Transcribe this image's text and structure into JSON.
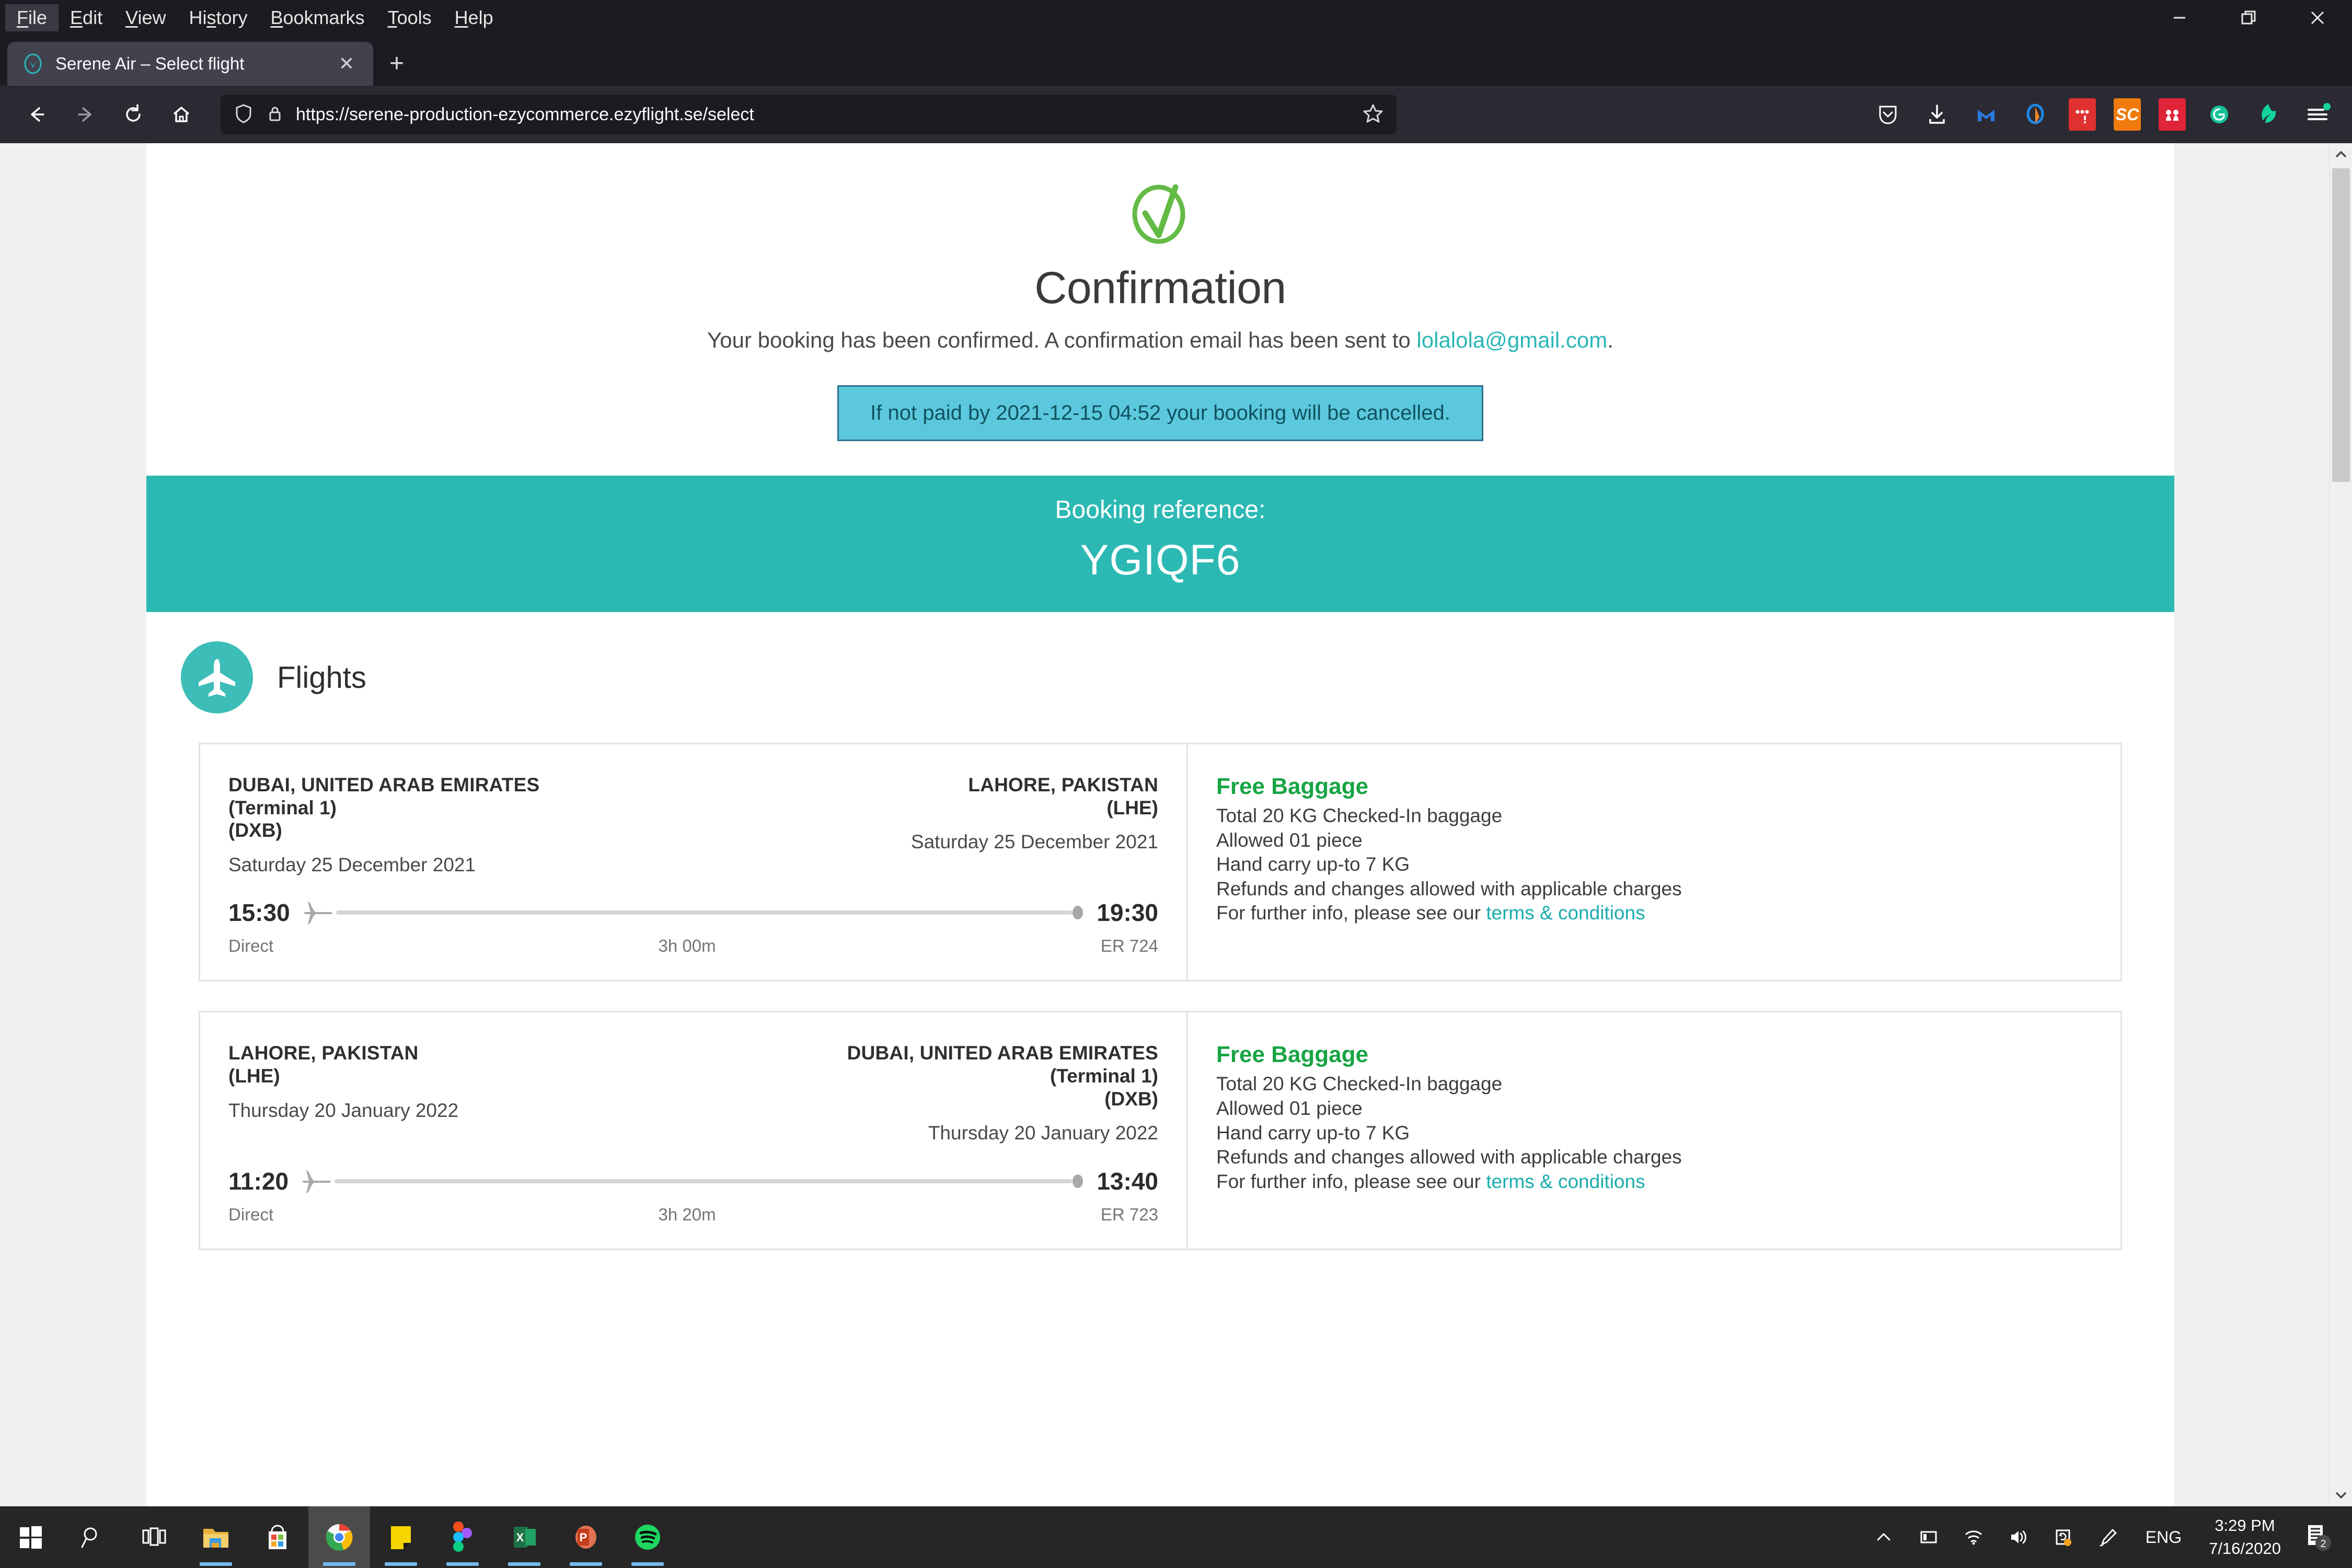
{
  "browser": {
    "menu": [
      {
        "label": "File",
        "accel": "F",
        "active": true
      },
      {
        "label": "Edit",
        "accel": "E",
        "active": false
      },
      {
        "label": "View",
        "accel": "V",
        "active": false
      },
      {
        "label": "History",
        "accel": "s",
        "active": false
      },
      {
        "label": "Bookmarks",
        "accel": "B",
        "active": false
      },
      {
        "label": "Tools",
        "accel": "T",
        "active": false
      },
      {
        "label": "Help",
        "accel": "H",
        "active": false
      }
    ],
    "tab": {
      "title": "Serene Air – Select flight",
      "close_label": "✕",
      "newtab_label": "+"
    },
    "url": "https://serene-production-ezycommerce.ezyflight.se/select",
    "extensions": [
      {
        "name": "pocket-icon",
        "label": ""
      },
      {
        "name": "downloads-icon",
        "label": ""
      },
      {
        "name": "malwarebytes-icon",
        "label": "M"
      },
      {
        "name": "origin-icon",
        "label": ""
      },
      {
        "name": "alert-extension-icon",
        "label": "!"
      },
      {
        "name": "sc-extension-icon",
        "label": "SC"
      },
      {
        "name": "m-extension-icon",
        "label": "M"
      },
      {
        "name": "grammarly-icon",
        "label": "G"
      },
      {
        "name": "leaf-extension-icon",
        "label": ""
      },
      {
        "name": "app-menu-icon",
        "label": ""
      }
    ],
    "window_buttons": {
      "minimize": "minimize-button",
      "restore": "restore-button",
      "close": "close-button"
    }
  },
  "page": {
    "confirmation": {
      "title": "Confirmation",
      "message_before": "Your booking has been confirmed. A confirmation email has been sent to ",
      "email": "lolalola@gmail.com",
      "message_after": ".",
      "warning": "If not paid by 2021-12-15 04:52 your booking will be cancelled."
    },
    "booking_reference": {
      "label": "Booking reference:",
      "code": "YGIQF6"
    },
    "flights_section": {
      "title": "Flights",
      "cards": [
        {
          "origin_name": "DUBAI, UNITED ARAB EMIRATES",
          "origin_terminal": "(Terminal 1)",
          "origin_code": "(DXB)",
          "origin_date": "Saturday 25 December 2021",
          "destination_name": "LAHORE, PAKISTAN",
          "destination_terminal": "",
          "destination_code": "(LHE)",
          "destination_date": "Saturday 25 December 2021",
          "depart_time": "15:30",
          "arrive_time": "19:30",
          "stops": "Direct",
          "duration": "3h 00m",
          "flight_number": "ER 724",
          "baggage_title": "Free Baggage",
          "baggage_lines": [
            "Total 20 KG Checked-In baggage",
            "Allowed 01 piece",
            "Hand carry up-to 7 KG",
            "Refunds and changes allowed with applicable charges"
          ],
          "baggage_footer_text": "For further info, please see our ",
          "baggage_link": "terms & conditions"
        },
        {
          "origin_name": "LAHORE, PAKISTAN",
          "origin_terminal": "",
          "origin_code": "(LHE)",
          "origin_date": "Thursday 20 January 2022",
          "destination_name": "DUBAI, UNITED ARAB EMIRATES",
          "destination_terminal": "(Terminal 1)",
          "destination_code": "(DXB)",
          "destination_date": "Thursday 20 January 2022",
          "depart_time": "11:20",
          "arrive_time": "13:40",
          "stops": "Direct",
          "duration": "3h 20m",
          "flight_number": "ER 723",
          "baggage_title": "Free Baggage",
          "baggage_lines": [
            "Total 20 KG Checked-In baggage",
            "Allowed 01 piece",
            "Hand carry up-to 7 KG",
            "Refunds and changes allowed with applicable charges"
          ],
          "baggage_footer_text": "For further info, please see our ",
          "baggage_link": "terms & conditions"
        }
      ]
    }
  },
  "taskbar": {
    "items": [
      {
        "name": "start-button",
        "open": false
      },
      {
        "name": "search-button",
        "open": false
      },
      {
        "name": "task-view-button",
        "open": false
      },
      {
        "name": "file-explorer-button",
        "open": true
      },
      {
        "name": "microsoft-store-button",
        "open": false
      },
      {
        "name": "chrome-button",
        "open": true,
        "active": true
      },
      {
        "name": "sticky-notes-button",
        "open": true
      },
      {
        "name": "figma-button",
        "open": true
      },
      {
        "name": "excel-button",
        "open": true
      },
      {
        "name": "powerpoint-button",
        "open": true
      },
      {
        "name": "spotify-button",
        "open": true
      }
    ],
    "tray": {
      "language": "ENG",
      "time": "3:29 PM",
      "date": "7/16/2020",
      "notification_count": "2"
    }
  },
  "colors": {
    "brand_teal": "#2cb9b4",
    "link_teal": "#1aacae",
    "baggage_green": "#17a444",
    "warning_bg": "#5bc8de",
    "warning_border": "#31708f",
    "chrome_dark": "#1c1b22"
  }
}
